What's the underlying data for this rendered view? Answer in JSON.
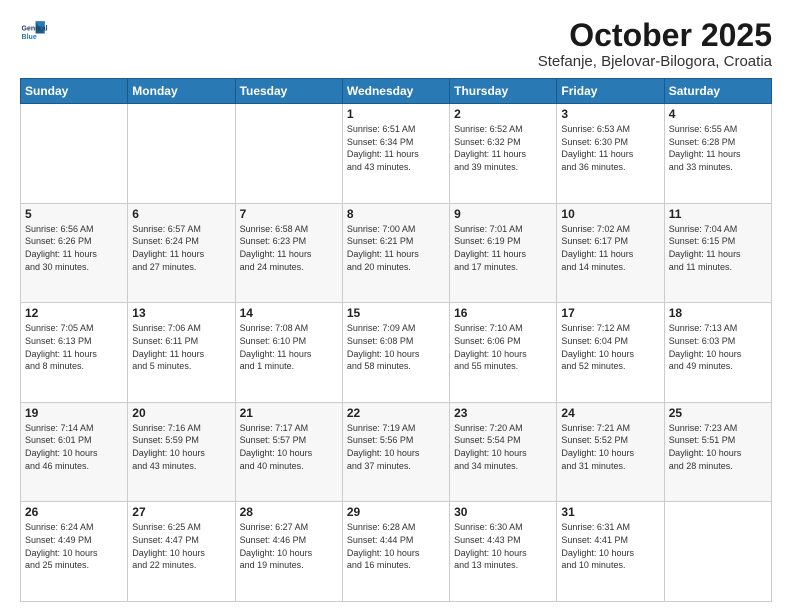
{
  "logo": {
    "line1": "General",
    "line2": "Blue"
  },
  "title": "October 2025",
  "subtitle": "Stefanje, Bjelovar-Bilogora, Croatia",
  "days_of_week": [
    "Sunday",
    "Monday",
    "Tuesday",
    "Wednesday",
    "Thursday",
    "Friday",
    "Saturday"
  ],
  "weeks": [
    [
      {
        "day": "",
        "info": ""
      },
      {
        "day": "",
        "info": ""
      },
      {
        "day": "",
        "info": ""
      },
      {
        "day": "1",
        "info": "Sunrise: 6:51 AM\nSunset: 6:34 PM\nDaylight: 11 hours\nand 43 minutes."
      },
      {
        "day": "2",
        "info": "Sunrise: 6:52 AM\nSunset: 6:32 PM\nDaylight: 11 hours\nand 39 minutes."
      },
      {
        "day": "3",
        "info": "Sunrise: 6:53 AM\nSunset: 6:30 PM\nDaylight: 11 hours\nand 36 minutes."
      },
      {
        "day": "4",
        "info": "Sunrise: 6:55 AM\nSunset: 6:28 PM\nDaylight: 11 hours\nand 33 minutes."
      }
    ],
    [
      {
        "day": "5",
        "info": "Sunrise: 6:56 AM\nSunset: 6:26 PM\nDaylight: 11 hours\nand 30 minutes."
      },
      {
        "day": "6",
        "info": "Sunrise: 6:57 AM\nSunset: 6:24 PM\nDaylight: 11 hours\nand 27 minutes."
      },
      {
        "day": "7",
        "info": "Sunrise: 6:58 AM\nSunset: 6:23 PM\nDaylight: 11 hours\nand 24 minutes."
      },
      {
        "day": "8",
        "info": "Sunrise: 7:00 AM\nSunset: 6:21 PM\nDaylight: 11 hours\nand 20 minutes."
      },
      {
        "day": "9",
        "info": "Sunrise: 7:01 AM\nSunset: 6:19 PM\nDaylight: 11 hours\nand 17 minutes."
      },
      {
        "day": "10",
        "info": "Sunrise: 7:02 AM\nSunset: 6:17 PM\nDaylight: 11 hours\nand 14 minutes."
      },
      {
        "day": "11",
        "info": "Sunrise: 7:04 AM\nSunset: 6:15 PM\nDaylight: 11 hours\nand 11 minutes."
      }
    ],
    [
      {
        "day": "12",
        "info": "Sunrise: 7:05 AM\nSunset: 6:13 PM\nDaylight: 11 hours\nand 8 minutes."
      },
      {
        "day": "13",
        "info": "Sunrise: 7:06 AM\nSunset: 6:11 PM\nDaylight: 11 hours\nand 5 minutes."
      },
      {
        "day": "14",
        "info": "Sunrise: 7:08 AM\nSunset: 6:10 PM\nDaylight: 11 hours\nand 1 minute."
      },
      {
        "day": "15",
        "info": "Sunrise: 7:09 AM\nSunset: 6:08 PM\nDaylight: 10 hours\nand 58 minutes."
      },
      {
        "day": "16",
        "info": "Sunrise: 7:10 AM\nSunset: 6:06 PM\nDaylight: 10 hours\nand 55 minutes."
      },
      {
        "day": "17",
        "info": "Sunrise: 7:12 AM\nSunset: 6:04 PM\nDaylight: 10 hours\nand 52 minutes."
      },
      {
        "day": "18",
        "info": "Sunrise: 7:13 AM\nSunset: 6:03 PM\nDaylight: 10 hours\nand 49 minutes."
      }
    ],
    [
      {
        "day": "19",
        "info": "Sunrise: 7:14 AM\nSunset: 6:01 PM\nDaylight: 10 hours\nand 46 minutes."
      },
      {
        "day": "20",
        "info": "Sunrise: 7:16 AM\nSunset: 5:59 PM\nDaylight: 10 hours\nand 43 minutes."
      },
      {
        "day": "21",
        "info": "Sunrise: 7:17 AM\nSunset: 5:57 PM\nDaylight: 10 hours\nand 40 minutes."
      },
      {
        "day": "22",
        "info": "Sunrise: 7:19 AM\nSunset: 5:56 PM\nDaylight: 10 hours\nand 37 minutes."
      },
      {
        "day": "23",
        "info": "Sunrise: 7:20 AM\nSunset: 5:54 PM\nDaylight: 10 hours\nand 34 minutes."
      },
      {
        "day": "24",
        "info": "Sunrise: 7:21 AM\nSunset: 5:52 PM\nDaylight: 10 hours\nand 31 minutes."
      },
      {
        "day": "25",
        "info": "Sunrise: 7:23 AM\nSunset: 5:51 PM\nDaylight: 10 hours\nand 28 minutes."
      }
    ],
    [
      {
        "day": "26",
        "info": "Sunrise: 6:24 AM\nSunset: 4:49 PM\nDaylight: 10 hours\nand 25 minutes."
      },
      {
        "day": "27",
        "info": "Sunrise: 6:25 AM\nSunset: 4:47 PM\nDaylight: 10 hours\nand 22 minutes."
      },
      {
        "day": "28",
        "info": "Sunrise: 6:27 AM\nSunset: 4:46 PM\nDaylight: 10 hours\nand 19 minutes."
      },
      {
        "day": "29",
        "info": "Sunrise: 6:28 AM\nSunset: 4:44 PM\nDaylight: 10 hours\nand 16 minutes."
      },
      {
        "day": "30",
        "info": "Sunrise: 6:30 AM\nSunset: 4:43 PM\nDaylight: 10 hours\nand 13 minutes."
      },
      {
        "day": "31",
        "info": "Sunrise: 6:31 AM\nSunset: 4:41 PM\nDaylight: 10 hours\nand 10 minutes."
      },
      {
        "day": "",
        "info": ""
      }
    ]
  ]
}
